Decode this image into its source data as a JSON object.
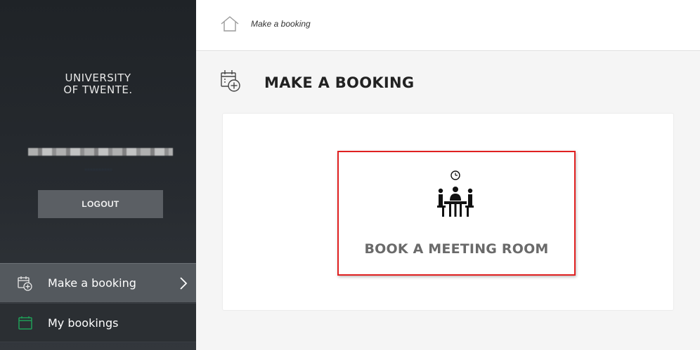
{
  "sidebar": {
    "logo_line1": "UNIVERSITY",
    "logo_line2": "OF TWENTE.",
    "logout_label": "LOGOUT",
    "nav": [
      {
        "label": "Make a booking",
        "icon": "calendar-add-icon",
        "active": true
      },
      {
        "label": "My bookings",
        "icon": "calendar-icon",
        "active": false
      }
    ]
  },
  "breadcrumb": {
    "home_icon": "home-icon",
    "current": "Make a booking"
  },
  "page": {
    "title": "MAKE A BOOKING",
    "icon": "calendar-add-icon"
  },
  "tiles": [
    {
      "label": "BOOK A MEETING ROOM",
      "icon": "meeting-room-icon"
    }
  ],
  "colors": {
    "highlight_border": "#e02020",
    "sidebar_bg": "#272b30",
    "nav_active_bg": "#54595e",
    "my_bookings_icon": "#1f9e57"
  }
}
